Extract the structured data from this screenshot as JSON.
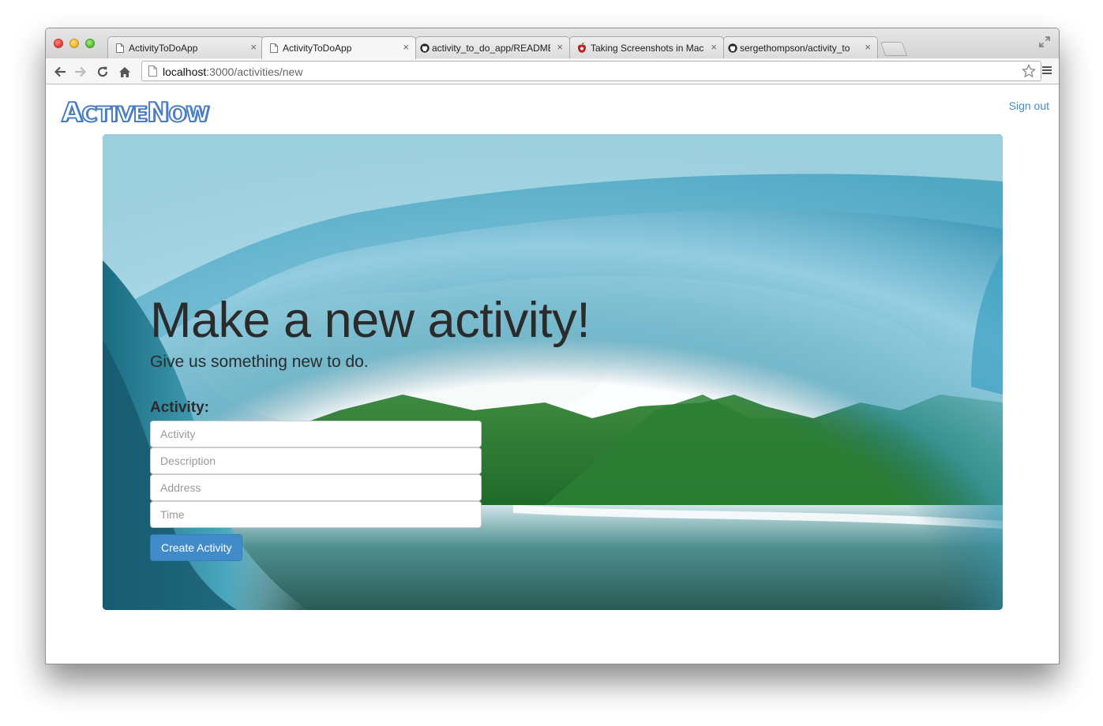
{
  "browser": {
    "tabs": [
      {
        "title": "ActivityToDoApp",
        "icon": "page-icon",
        "active": false
      },
      {
        "title": "ActivityToDoApp",
        "icon": "page-icon",
        "active": true
      },
      {
        "title": "activity_to_do_app/README",
        "icon": "github-icon",
        "active": false
      },
      {
        "title": "Taking Screenshots in Mac",
        "icon": "apple-icon",
        "active": false
      },
      {
        "title": "sergethompson/activity_to",
        "icon": "github-icon",
        "active": false
      }
    ],
    "tab_close_glyph": "×",
    "url_host": "localhost",
    "url_rest": ":3000/activities/new"
  },
  "header": {
    "logo_text_word1_cap": "A",
    "logo_text_word1_rest": "CTIVE",
    "logo_text_word2_cap": "N",
    "logo_text_word2_rest": "OW",
    "signout_label": "Sign out"
  },
  "hero": {
    "title": "Make a new activity!",
    "lead": "Give us something new to do.",
    "form_label": "Activity:",
    "fields": [
      {
        "name": "activity",
        "placeholder": "Activity"
      },
      {
        "name": "description",
        "placeholder": "Description"
      },
      {
        "name": "address",
        "placeholder": "Address"
      },
      {
        "name": "time",
        "placeholder": "Time"
      }
    ],
    "submit_label": "Create Activity"
  },
  "colors": {
    "accent": "#428bca",
    "logo": "#4a7fc1"
  }
}
